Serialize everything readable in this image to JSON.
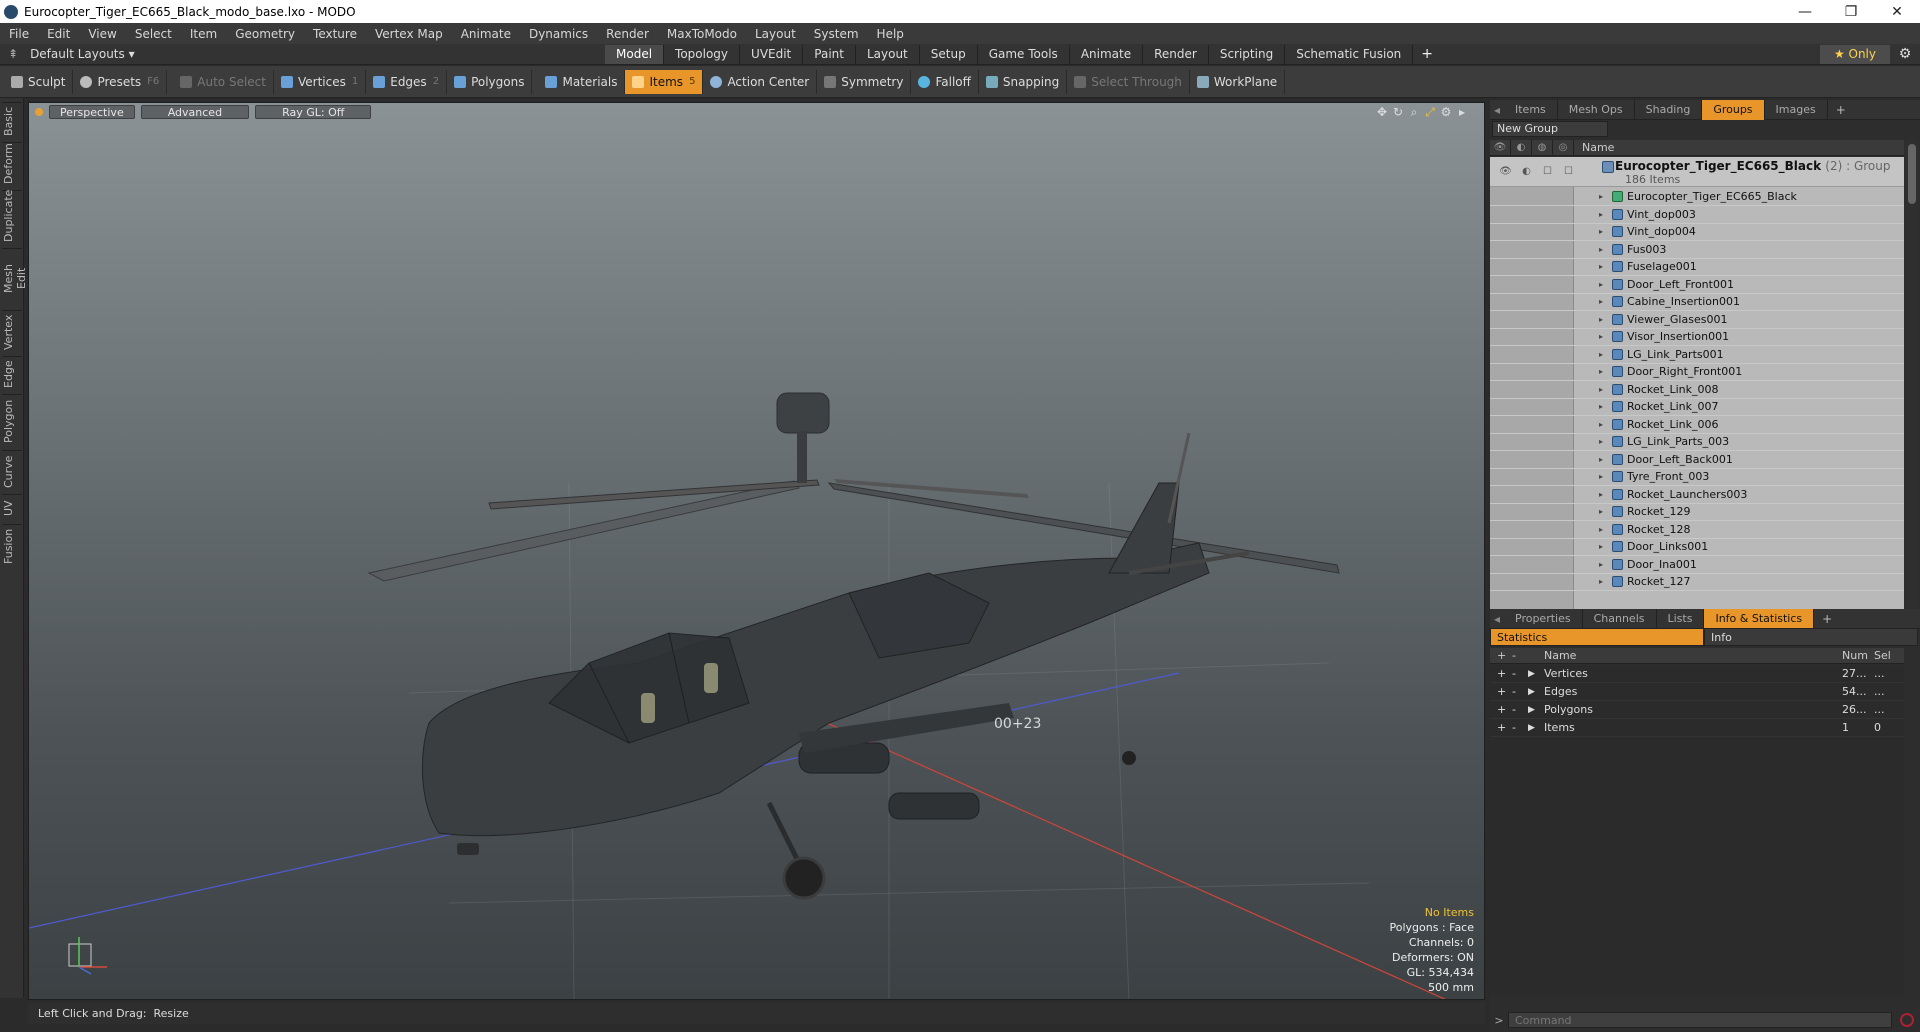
{
  "window": {
    "title": "Eurocopter_Tiger_EC665_Black_modo_base.lxo - MODO",
    "controls": [
      "—",
      "❐",
      "✕"
    ]
  },
  "menu": [
    "File",
    "Edit",
    "View",
    "Select",
    "Item",
    "Geometry",
    "Texture",
    "Vertex Map",
    "Animate",
    "Dynamics",
    "Render",
    "MaxToModo",
    "Layout",
    "System",
    "Help"
  ],
  "modebar": {
    "layouts_label": "Default Layouts ▾",
    "tabs": [
      "Model",
      "Topology",
      "UVEdit",
      "Paint",
      "Layout",
      "Setup",
      "Game Tools",
      "Animate",
      "Render",
      "Scripting",
      "Schematic Fusion"
    ],
    "active_tab": "Model",
    "plus": "+",
    "only_label": "★  Only"
  },
  "toolbar": {
    "sculpt": "Sculpt",
    "presets": "Presets",
    "presets_key": "F6",
    "auto_select": "Auto Select",
    "vertices": "Vertices",
    "vertices_key": "1",
    "edges": "Edges",
    "edges_key": "2",
    "polygons": "Polygons",
    "materials": "Materials",
    "items": "Items",
    "items_key": "5",
    "action_center": "Action Center",
    "symmetry": "Symmetry",
    "falloff": "Falloff",
    "snapping": "Snapping",
    "select_through": "Select Through",
    "workplane": "WorkPlane"
  },
  "left_tabs": [
    "Basic",
    "Deform",
    "Duplicate",
    "Mesh Edit",
    "Vertex",
    "Edge",
    "Polygon",
    "Curve",
    "UV",
    "Fusion"
  ],
  "viewport": {
    "view_mode": "Perspective",
    "shading": "Advanced",
    "raygl": "Ray GL: Off",
    "info": {
      "no_items": "No Items",
      "polygons": "Polygons : Face",
      "channels": "Channels: 0",
      "deformers": "Deformers: ON",
      "gl": "GL: 534,434",
      "scale": "500 mm"
    },
    "fuselage_marking": "00+23"
  },
  "status": {
    "left": "Left Click and Drag:",
    "right": "Resize"
  },
  "panel_top": {
    "tabs": [
      "Items",
      "Mesh Ops",
      "Shading",
      "Groups",
      "Images"
    ],
    "active_tab": "Groups",
    "new_group": "New Group",
    "header_name": "Name",
    "root": {
      "name": "Eurocopter_Tiger_EC665_Black",
      "count": "(2) : Group",
      "sub": "186 Items"
    },
    "items": [
      "Eurocopter_Tiger_EC665_Black",
      "Vint_dop003",
      "Vint_dop004",
      "Fus003",
      "Fuselage001",
      "Door_Left_Front001",
      "Cabine_Insertion001",
      "Viewer_Glases001",
      "Visor_Insertion001",
      "LG_Link_Parts001",
      "Door_Right_Front001",
      "Rocket_Link_008",
      "Rocket_Link_007",
      "Rocket_Link_006",
      "LG_Link_Parts_003",
      "Door_Left_Back001",
      "Tyre_Front_003",
      "Rocket_Launchers003",
      "Rocket_129",
      "Rocket_128",
      "Door_Links001",
      "Door_Ina001",
      "Rocket_127"
    ]
  },
  "panel_bottom": {
    "tabs": [
      "Properties",
      "Channels",
      "Lists",
      "Info & Statistics"
    ],
    "active_tab": "Info & Statistics",
    "sub_tabs": [
      "Statistics",
      "Info"
    ],
    "headers": {
      "name": "Name",
      "num": "Num",
      "sel": "Sel"
    },
    "rows": [
      {
        "name": "Vertices",
        "num": "27...",
        "sel": "..."
      },
      {
        "name": "Edges",
        "num": "54...",
        "sel": "..."
      },
      {
        "name": "Polygons",
        "num": "26...",
        "sel": "..."
      },
      {
        "name": "Items",
        "num": "1",
        "sel": "0"
      }
    ]
  },
  "command": {
    "placeholder": "Command"
  },
  "colors": {
    "accent": "#e8962a",
    "viewport_top": "#8a9296",
    "viewport_bottom": "#3c4144",
    "info_highlight": "#f1c232"
  }
}
